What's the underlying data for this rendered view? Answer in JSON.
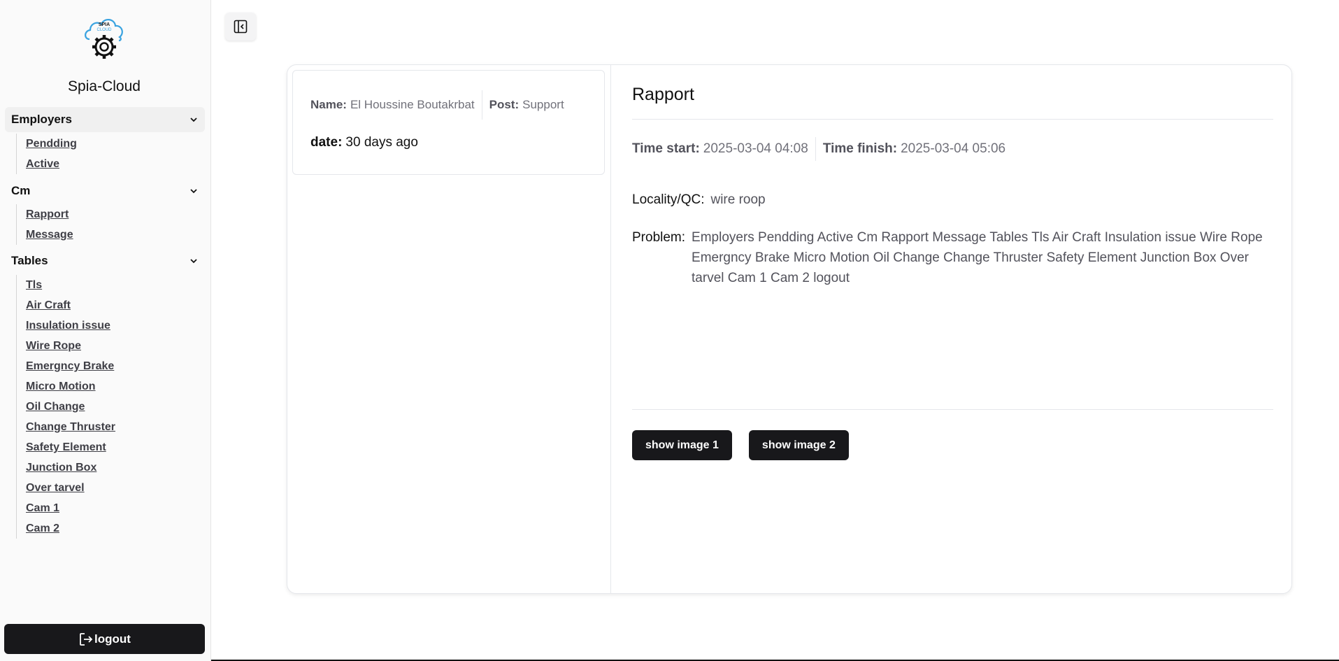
{
  "sidebar": {
    "brand": "Spia-Cloud",
    "logo_text": "SPIA CLOUD",
    "groups": [
      {
        "label": "Employers",
        "items": [
          "Pendding",
          "Active"
        ]
      },
      {
        "label": "Cm",
        "items": [
          "Rapport",
          "Message"
        ]
      },
      {
        "label": "Tables",
        "items": [
          "Tls",
          "Air Craft",
          "Insulation issue",
          "Wire Rope",
          "Emergncy Brake",
          "Micro Motion",
          "Oil Change",
          "Change Thruster",
          "Safety Element",
          "Junction Box",
          "Over tarvel",
          "Cam 1",
          "Cam 2"
        ]
      }
    ],
    "logout_label": "logout"
  },
  "employee": {
    "name_label": "Name:",
    "name_value": "El Houssine Boutakrbat",
    "post_label": "Post:",
    "post_value": "Support",
    "date_label": "date:",
    "date_value": "30 days ago"
  },
  "report": {
    "title": "Rapport",
    "time_start_label": "Time start:",
    "time_start_value": "2025-03-04 04:08",
    "time_finish_label": "Time finish:",
    "time_finish_value": "2025-03-04 05:06",
    "locality_label": "Locality/QC:",
    "locality_value": "wire roop",
    "problem_label": "Problem:",
    "problem_value": "Employers Pendding Active Cm Rapport Message Tables Tls Air Craft Insulation issue Wire Rope Emergncy Brake Micro Motion Oil Change Change Thruster Safety Element Junction Box Over tarvel Cam 1 Cam 2 logout",
    "buttons": [
      "show image 1",
      "show image 2"
    ]
  },
  "icons": {
    "logo": "cloud-gear-logo",
    "chevron": "chevron-down-icon",
    "toggle": "sidebar-toggle-icon",
    "logout": "logout-icon"
  },
  "colors": {
    "accent": "#18181b",
    "logo_blue": "#3aa3e0"
  }
}
